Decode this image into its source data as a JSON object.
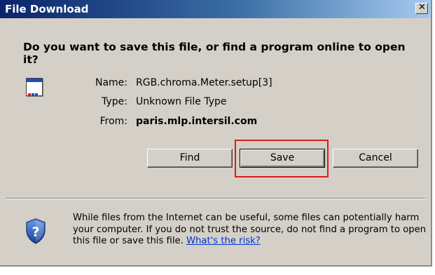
{
  "window": {
    "title": "File Download",
    "close_symbol": "✕"
  },
  "dialog": {
    "question": "Do you want to save this file, or find a program online to open it?",
    "info": {
      "name_label": "Name:",
      "name_value": "RGB.chroma.Meter.setup[3]",
      "type_label": "Type:",
      "type_value": "Unknown File Type",
      "from_label": "From:",
      "from_value": "paris.mlp.intersil.com"
    },
    "buttons": {
      "find": "Find",
      "save": "Save",
      "cancel": "Cancel"
    },
    "warning": {
      "text": "While files from the Internet can be useful, some files can potentially harm your computer. If you do not trust the source, do not find a program to open this file or save this file. ",
      "link": "What's the risk?"
    }
  },
  "icons": {
    "file": "file-type-icon",
    "shield": "security-shield-question-icon",
    "close": "close-icon"
  },
  "colors": {
    "title_bar_start": "#0a246a",
    "title_bar_end": "#a6caf0",
    "dialog_bg": "#d4d0c8",
    "highlight": "#e01919",
    "link": "#0033cc"
  }
}
